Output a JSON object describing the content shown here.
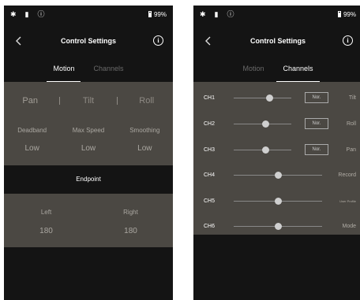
{
  "status_bar": {
    "battery": "99%"
  },
  "header": {
    "title": "Control Settings",
    "back_icon": "chevron-left-icon",
    "info_icon": "info-icon",
    "info_glyph": "i"
  },
  "tabs": [
    {
      "label": "Motion"
    },
    {
      "label": "Channels"
    }
  ],
  "motion": {
    "axes": [
      {
        "label": "Pan",
        "active": true
      },
      {
        "label": "Tilt",
        "active": false
      },
      {
        "label": "Roll",
        "active": false
      }
    ],
    "params": [
      {
        "label": "Deadband",
        "value": "Low"
      },
      {
        "label": "Max Speed",
        "value": "Low"
      },
      {
        "label": "Smoothing",
        "value": "Low"
      }
    ],
    "endpoint": {
      "title": "Endpoint",
      "left": {
        "label": "Left",
        "value": "180"
      },
      "right": {
        "label": "Right",
        "value": "180"
      }
    }
  },
  "channels": [
    {
      "id": "CH1",
      "value": 0.62,
      "nor": "Nor.",
      "function": "Tilt"
    },
    {
      "id": "CH2",
      "value": 0.56,
      "nor": "Nor.",
      "function": "Roll"
    },
    {
      "id": "CH3",
      "value": 0.56,
      "nor": "Nor.",
      "function": "Pan"
    },
    {
      "id": "CH4",
      "value": 0.5,
      "nor": null,
      "function": "Record"
    },
    {
      "id": "CH5",
      "value": 0.5,
      "nor": null,
      "function": "User Profile"
    },
    {
      "id": "CH6",
      "value": 0.5,
      "nor": null,
      "function": "Mode"
    }
  ]
}
